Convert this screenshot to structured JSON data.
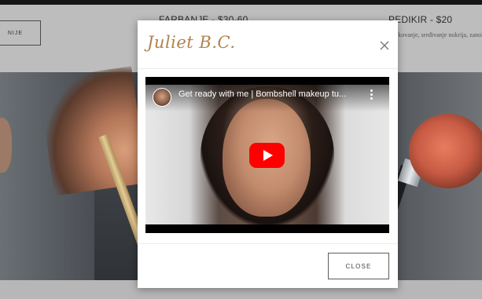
{
  "background": {
    "services": [
      {
        "label": "FARBANJE - $30-60"
      },
      {
        "label": "PEDIKIR - $20",
        "description": "Oblikovanje, sređivanje nokrija, zanokrice"
      }
    ],
    "left_button_label": "NIJE"
  },
  "modal": {
    "title": "Juliet B.C.",
    "close_icon": "close-x-icon",
    "video": {
      "title": "Get ready with me | Bombshell makeup tu...",
      "play_icon": "youtube-play-icon",
      "menu_icon": "kebab-menu-icon"
    },
    "close_button_label": "CLOSE"
  },
  "colors": {
    "title": "#b0824d",
    "play": "#ff0000"
  }
}
